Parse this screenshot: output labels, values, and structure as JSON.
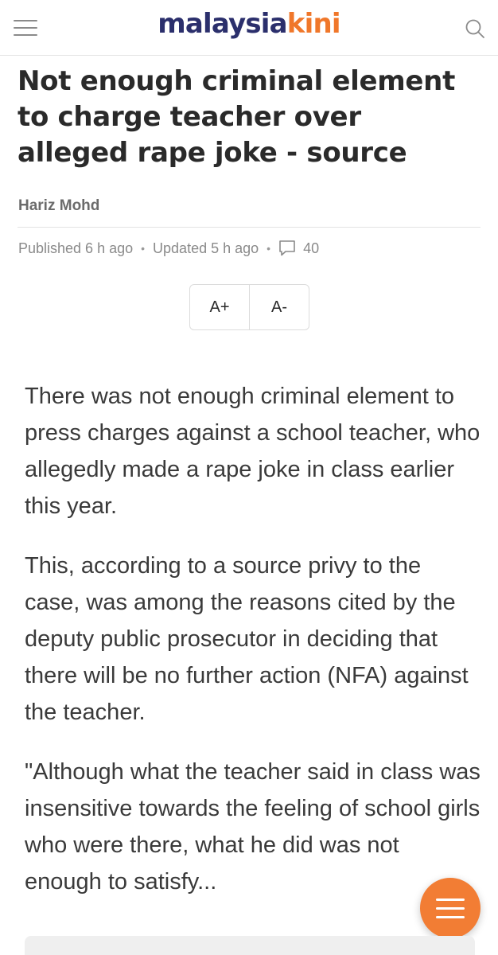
{
  "header": {
    "logo_part1": "malaysia",
    "logo_part2": "kini",
    "menu_icon": "hamburger-menu-icon",
    "search_icon": "search-icon",
    "brand_navy": "#2b2f6c",
    "brand_orange": "#f0772a"
  },
  "article": {
    "title": "Not enough criminal element to charge teacher over alleged rape joke - source",
    "author": "Hariz Mohd",
    "published": "Published 6 h ago",
    "updated": "Updated 5 h ago",
    "comment_icon": "comment-bubble-icon",
    "comment_count": "40",
    "font_increase": "A+",
    "font_decrease": "A-",
    "paragraphs": [
      "There was not enough criminal element to press charges against a school teacher, who allegedly made a rape joke in class earlier this year.",
      "This, according to a source privy to the case, was among the reasons cited by the deputy public prosecutor in deciding that there will be no further action (NFA) against the teacher.",
      "\"Although what the teacher said in class was insensitive towards the feeling of school girls who were there, what he did was not enough to satisfy..."
    ]
  },
  "fab": {
    "icon": "menu-icon",
    "color": "#f27d34"
  }
}
